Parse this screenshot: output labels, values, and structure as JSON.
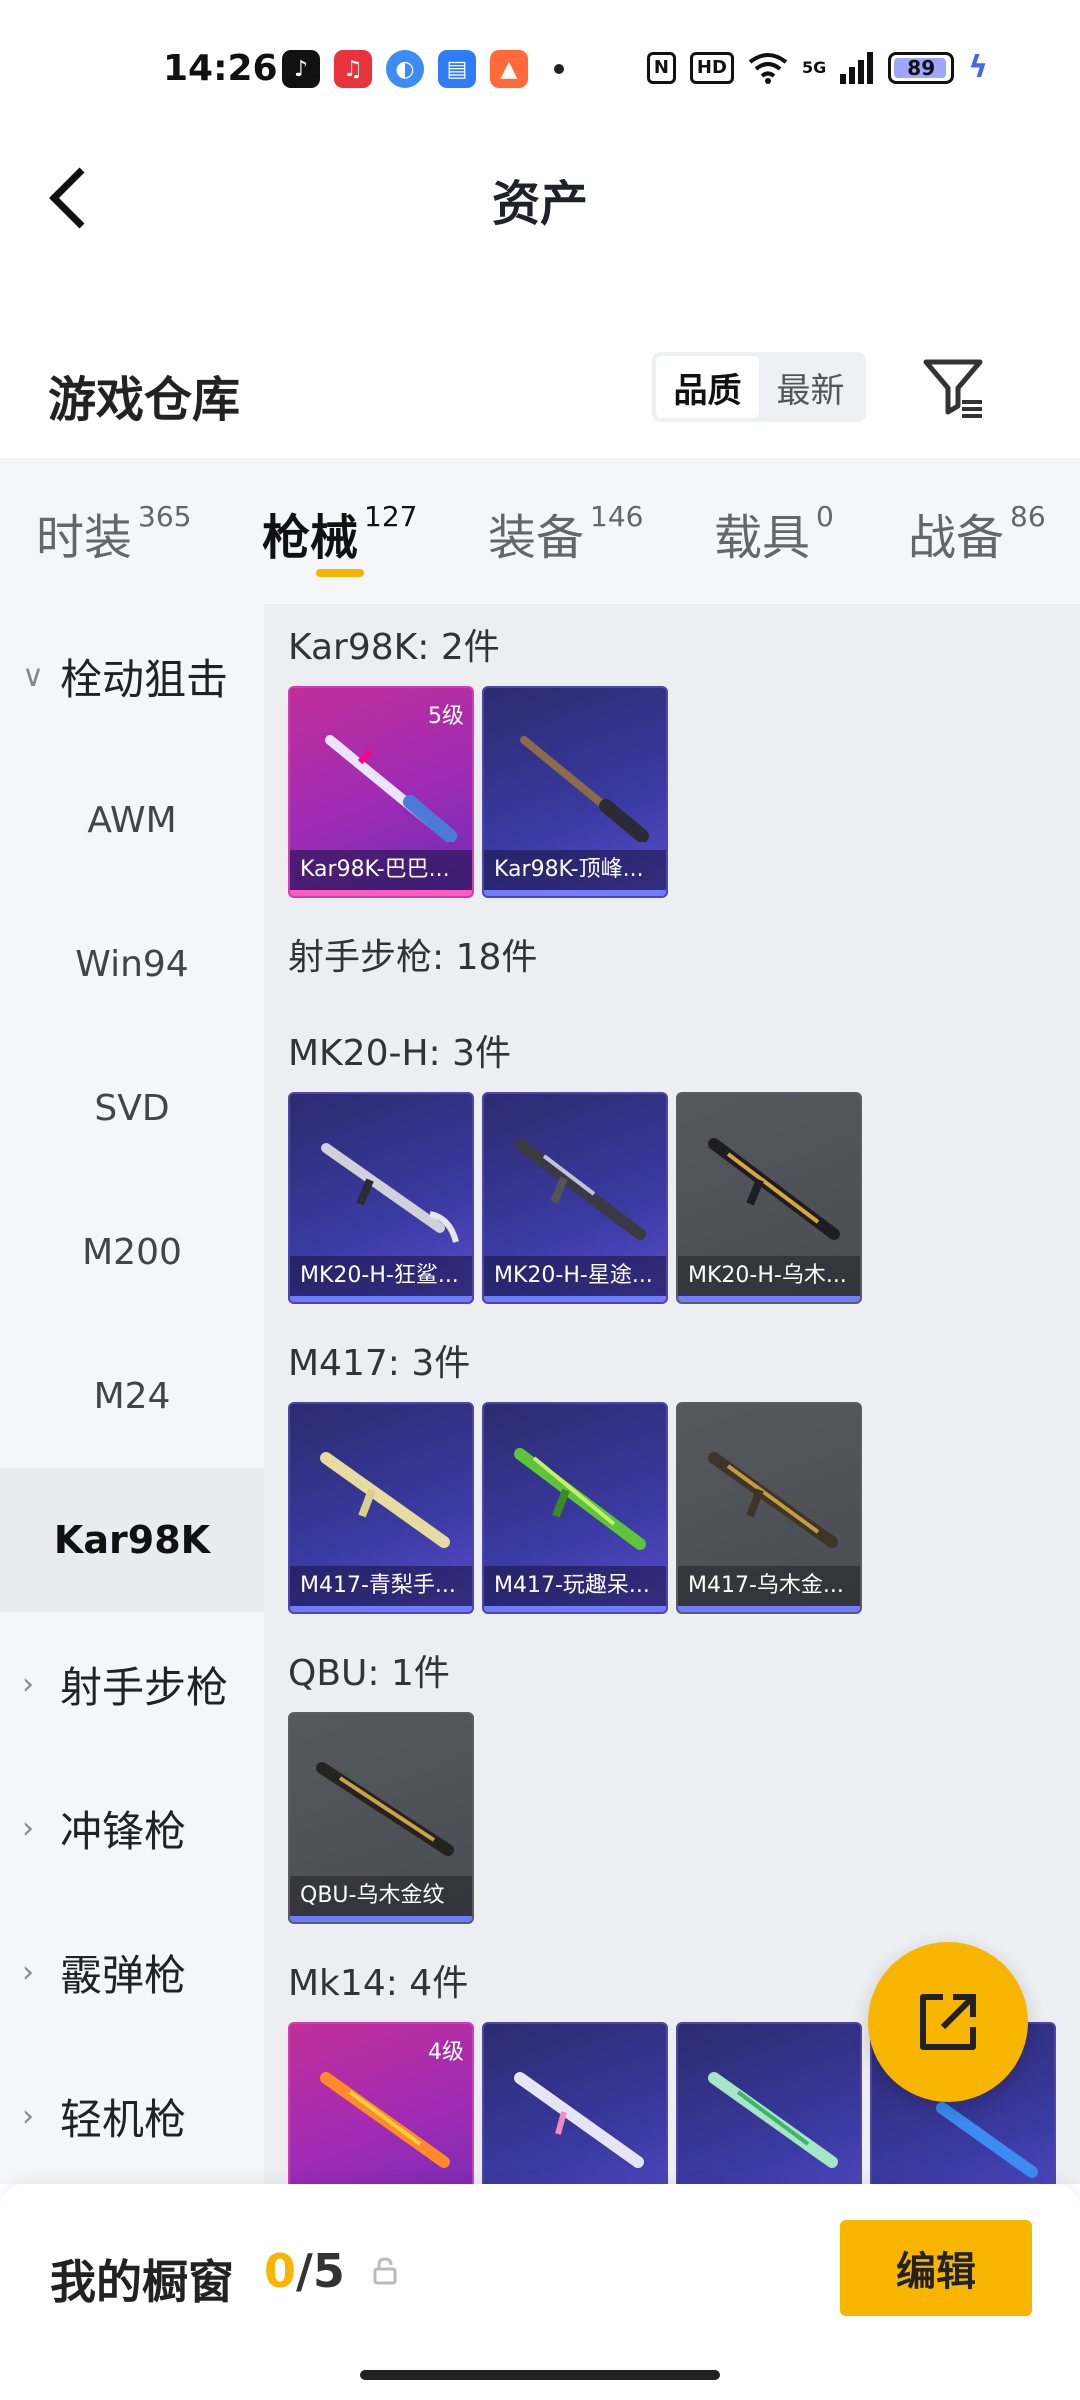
{
  "status_bar": {
    "time": "14:26",
    "nfc": "N",
    "hd": "HD",
    "network": "5G",
    "battery": "89"
  },
  "header": {
    "title": "资产"
  },
  "section": {
    "title": "游戏仓库"
  },
  "sort": {
    "quality": "品质",
    "newest": "最新"
  },
  "tabs": [
    {
      "label": "时装",
      "count": "365"
    },
    {
      "label": "枪械",
      "count": "127"
    },
    {
      "label": "装备",
      "count": "146"
    },
    {
      "label": "载具",
      "count": "0"
    },
    {
      "label": "战备",
      "count": "86"
    }
  ],
  "leftnav": {
    "group_sniper": "栓动狙击",
    "items": [
      "AWM",
      "Win94",
      "SVD",
      "M200",
      "M24",
      "Kar98K"
    ],
    "group_marksman": "射手步枪",
    "group_smg": "冲锋枪",
    "group_shotgun": "霰弹枪",
    "group_lmg": "轻机枪"
  },
  "content": {
    "kar98k_label": "Kar98K: 2件",
    "kar98k_items": [
      {
        "name": "Kar98K-巴巴...",
        "level": "5级"
      },
      {
        "name": "Kar98K-顶峰..."
      }
    ],
    "marksman_label": "射手步枪: 18件",
    "mk20_label": "MK20-H: 3件",
    "mk20_items": [
      {
        "name": "MK20-H-狂鲨..."
      },
      {
        "name": "MK20-H-星途..."
      },
      {
        "name": "MK20-H-乌木..."
      }
    ],
    "m417_label": "M417: 3件",
    "m417_items": [
      {
        "name": "M417-青梨手..."
      },
      {
        "name": "M417-玩趣呆..."
      },
      {
        "name": "M417-乌木金..."
      }
    ],
    "qbu_label": "QBU: 1件",
    "qbu_items": [
      {
        "name": "QBU-乌木金纹"
      }
    ],
    "mk14_label": "Mk14: 4件",
    "mk14_items": [
      {
        "level": "4级"
      }
    ]
  },
  "bottom": {
    "showcase_label": "我的橱窗",
    "showcase_used": "0",
    "showcase_total": "/5",
    "edit_label": "编辑"
  },
  "colors": {
    "accent": "#f7b500",
    "tab_bg": "#f4f6f9",
    "content_bg": "#eceef2"
  }
}
